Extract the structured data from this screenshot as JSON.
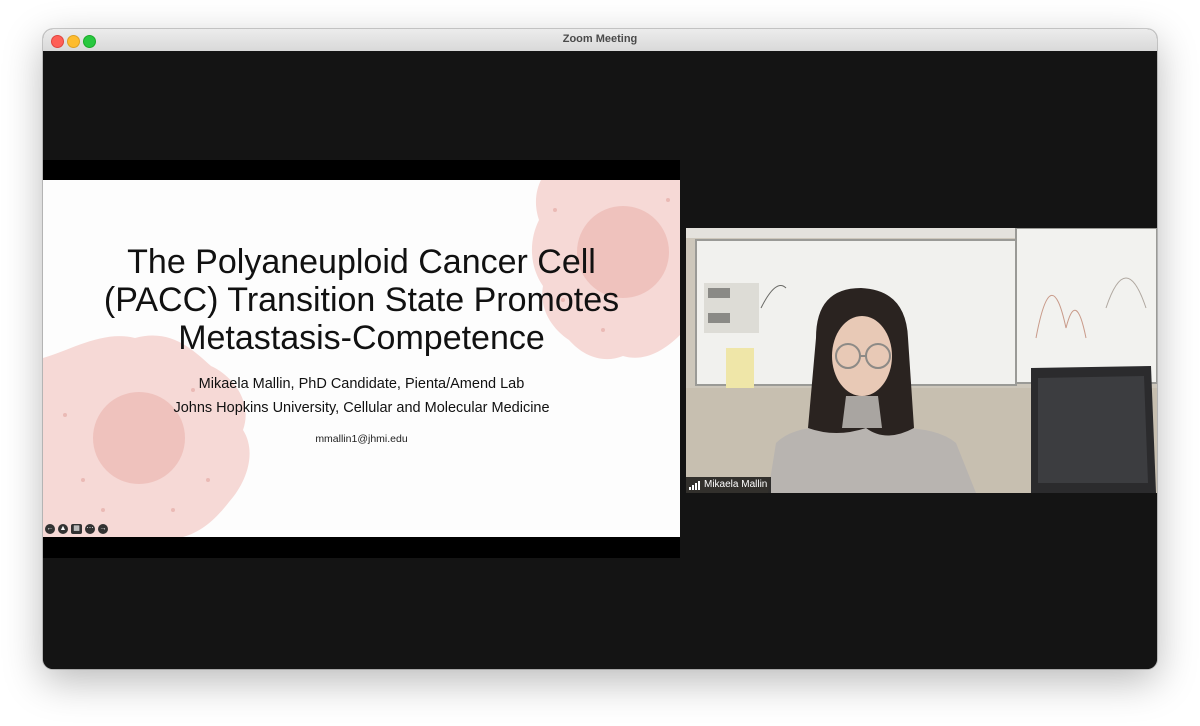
{
  "window": {
    "title": "Zoom Meeting"
  },
  "slide": {
    "title_lines": [
      "The Polyaneuploid Cancer Cell",
      "(PACC) Transition State Promotes",
      "Metastasis-Competence"
    ],
    "author": "Mikaela Mallin, PhD Candidate, Pienta/Amend Lab",
    "affiliation": "Johns Hopkins University, Cellular and Molecular Medicine",
    "email": "mmallin1@jhmi.edu"
  },
  "slide_controls": {
    "prev_icon": "arrow-left-icon",
    "pen_icon": "pen-icon",
    "captions_icon": "captions-icon",
    "more_icon": "more-icon",
    "next_icon": "arrow-right-icon"
  },
  "participant": {
    "name": "Mikaela Mallin",
    "signal_icon": "signal-bars-icon"
  },
  "colors": {
    "stage_bg": "#141414",
    "cell_pink": "#f6d9d6",
    "cell_core": "#efc2bd"
  }
}
